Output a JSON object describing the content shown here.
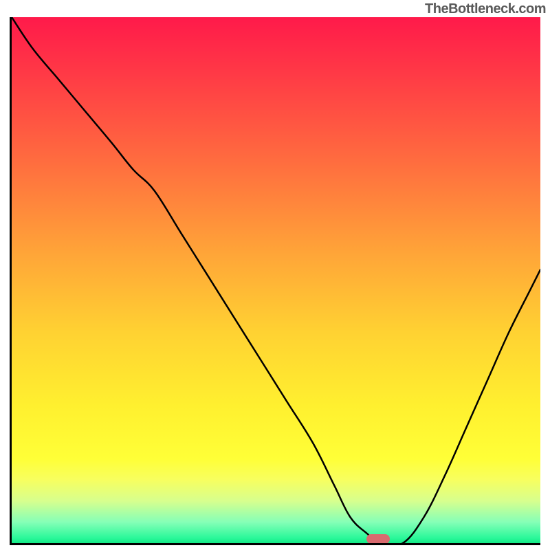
{
  "watermark": "TheBottleneck.com",
  "colors": {
    "curve": "#000000",
    "marker": "#d96a6f",
    "axis": "#000000"
  },
  "chart_data": {
    "type": "line",
    "title": "",
    "xlabel": "",
    "ylabel": "",
    "xlim": [
      0,
      100
    ],
    "ylim": [
      0,
      100
    ],
    "gradient_stops": [
      {
        "pct": 0,
        "color": "#ff1a4a"
      },
      {
        "pct": 10,
        "color": "#ff3746"
      },
      {
        "pct": 27,
        "color": "#ff6b3f"
      },
      {
        "pct": 45,
        "color": "#ffa538"
      },
      {
        "pct": 60,
        "color": "#ffd232"
      },
      {
        "pct": 74,
        "color": "#fff02f"
      },
      {
        "pct": 84,
        "color": "#ffff37"
      },
      {
        "pct": 88,
        "color": "#f7ff60"
      },
      {
        "pct": 92,
        "color": "#d7ff8e"
      },
      {
        "pct": 96,
        "color": "#85ffb7"
      },
      {
        "pct": 99,
        "color": "#2bf89a"
      },
      {
        "pct": 100,
        "color": "#13e885"
      }
    ],
    "series": [
      {
        "name": "bottleneck-curve",
        "x": [
          0,
          4,
          9,
          14,
          19,
          23,
          27,
          32,
          37,
          42,
          47,
          52,
          57,
          61,
          64,
          67,
          70,
          74,
          78,
          82,
          86,
          90,
          94,
          98,
          100
        ],
        "y": [
          100,
          94,
          88,
          82,
          76,
          71,
          67,
          59,
          51,
          43,
          35,
          27,
          19,
          11,
          5,
          2,
          0,
          0,
          5,
          13,
          22,
          31,
          40,
          48,
          52
        ]
      }
    ],
    "marker": {
      "x": 69,
      "y": 0.8
    }
  }
}
